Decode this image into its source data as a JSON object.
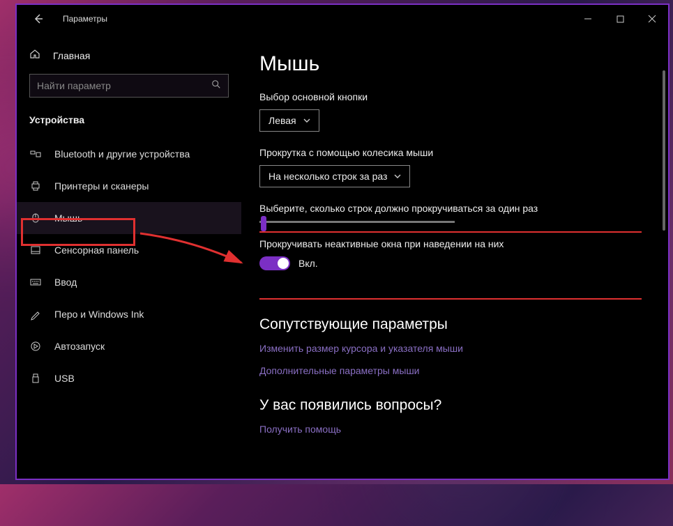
{
  "window": {
    "app_title": "Параметры"
  },
  "sidebar": {
    "home_label": "Главная",
    "search_placeholder": "Найти параметр",
    "section_title": "Устройства",
    "items": [
      {
        "label": "Bluetooth и другие устройства"
      },
      {
        "label": "Принтеры и сканеры"
      },
      {
        "label": "Мышь"
      },
      {
        "label": "Сенсорная панель"
      },
      {
        "label": "Ввод"
      },
      {
        "label": "Перо и Windows Ink"
      },
      {
        "label": "Автозапуск"
      },
      {
        "label": "USB"
      }
    ]
  },
  "main": {
    "page_title": "Мышь",
    "primary_button": {
      "label": "Выбор основной кнопки",
      "value": "Левая"
    },
    "scroll_method": {
      "label": "Прокрутка с помощью колесика мыши",
      "value": "На несколько строк за раз"
    },
    "lines_label": "Выберите, сколько строк должно прокручиваться за один раз",
    "inactive_scroll": {
      "label": "Прокручивать неактивные окна при наведении на них",
      "state_label": "Вкл."
    },
    "related_title": "Сопутствующие параметры",
    "link_cursor": "Изменить размер курсора и указателя мыши",
    "link_adv": "Дополнительные параметры мыши",
    "questions_title": "У вас появились вопросы?",
    "link_help": "Получить помощь"
  }
}
